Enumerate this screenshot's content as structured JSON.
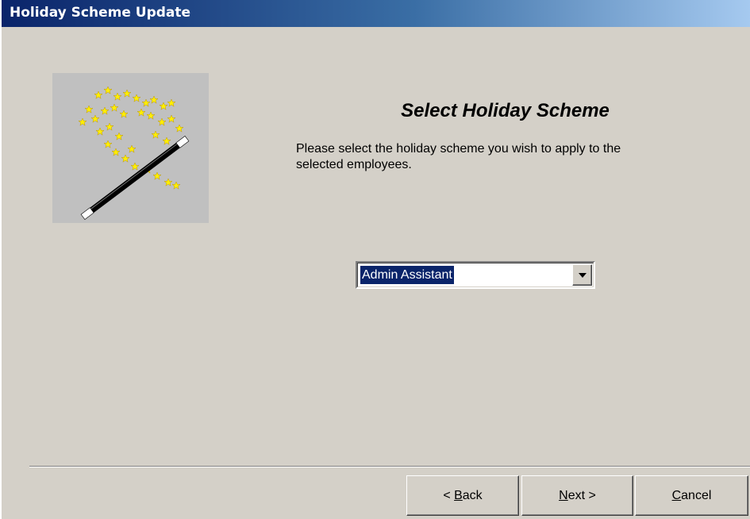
{
  "window": {
    "title": "Holiday Scheme Update"
  },
  "wizard": {
    "image_icon": "magic-wand-stars-icon",
    "heading": "Select Holiday Scheme",
    "description_line1": "Please select the holiday scheme you wish to apply to the",
    "description_line2": "selected employees."
  },
  "scheme_select": {
    "selected_value": "Admin Assistant"
  },
  "buttons": {
    "back_prefix": "< ",
    "back_mnemonic": "B",
    "back_rest": "ack",
    "next_mnemonic": "N",
    "next_rest": "ext >",
    "cancel_mnemonic": "C",
    "cancel_rest": "ancel"
  },
  "colors": {
    "title_gradient_start": "#0a246a",
    "title_gradient_end": "#a6caf0",
    "dialog_background": "#d4d0c8",
    "selection_highlight": "#0a246a",
    "star_yellow": "#ffee00"
  }
}
